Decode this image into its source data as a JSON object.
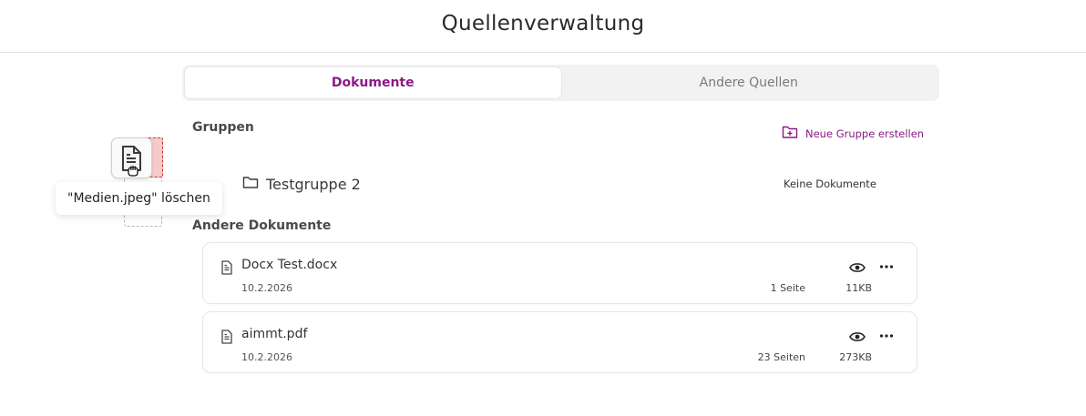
{
  "header": {
    "title": "Quellenverwaltung"
  },
  "tabs": [
    {
      "label": "Dokumente",
      "active": true
    },
    {
      "label": "Andere Quellen",
      "active": false
    }
  ],
  "groups": {
    "label": "Gruppen",
    "new_group_label": "Neue Gruppe erstellen",
    "items": [
      {
        "name": "Testgruppe 2",
        "status": "Keine Dokumente"
      }
    ]
  },
  "documents": {
    "label": "Andere Dokumente",
    "items": [
      {
        "name": "Docx Test.docx",
        "date": "10.2.2026",
        "pages": "1 Seite",
        "size": "11KB"
      },
      {
        "name": "aimmt.pdf",
        "date": "10.2.2026",
        "pages": "23 Seiten",
        "size": "273KB"
      }
    ]
  },
  "drag": {
    "tooltip": "\"Medien.jpeg\" löschen",
    "icons": [
      "file-icon",
      "grab-hand-cursor-icon"
    ]
  },
  "colors": {
    "accent": "#8a1a86",
    "delete_zone": "#f7c9c9",
    "delete_border": "#c0392b"
  }
}
